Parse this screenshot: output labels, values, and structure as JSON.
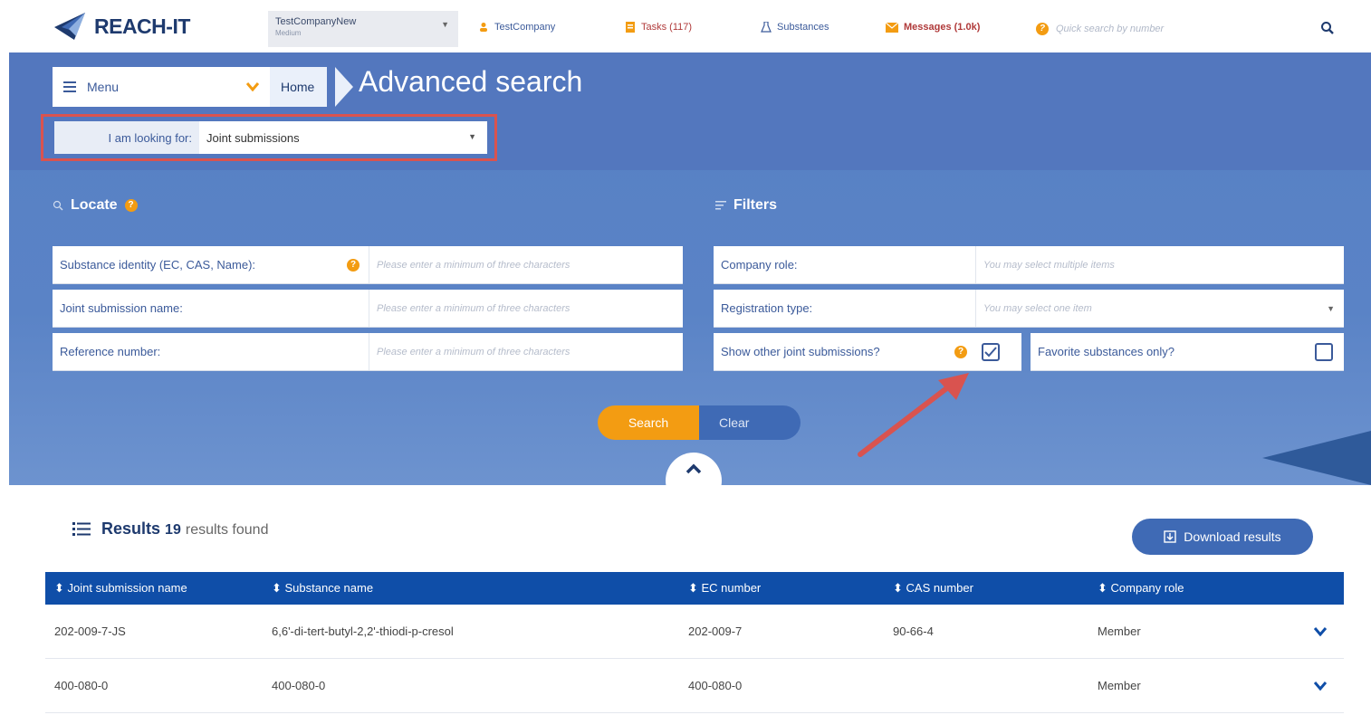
{
  "header": {
    "logo_text": "REACH-IT",
    "company": {
      "name": "TestCompanyNew",
      "size": "Medium"
    },
    "user": "TestCompany",
    "tasks": "Tasks (117)",
    "substances": "Substances",
    "messages": "Messages (1.0k)",
    "quick_search_placeholder": "Quick search by number"
  },
  "nav": {
    "menu_label": "Menu",
    "breadcrumb_home": "Home",
    "page_title": "Advanced search"
  },
  "looking_for": {
    "label": "I am looking for:",
    "value": "Joint submissions"
  },
  "locate": {
    "title": "Locate",
    "fields": [
      {
        "label": "Substance identity (EC, CAS, Name):",
        "placeholder": "Please enter a minimum of three characters"
      },
      {
        "label": "Joint submission name:",
        "placeholder": "Please enter a minimum of three characters"
      },
      {
        "label": "Reference number:",
        "placeholder": "Please enter a minimum of three characters"
      }
    ]
  },
  "filters": {
    "title": "Filters",
    "company_role": {
      "label": "Company role:",
      "placeholder": "You may select multiple items"
    },
    "registration_type": {
      "label": "Registration type:",
      "placeholder": "You may select one item"
    },
    "show_other": {
      "label": "Show other joint submissions?",
      "checked": true
    },
    "favorite_only": {
      "label": "Favorite substances only?",
      "checked": false
    }
  },
  "actions": {
    "search": "Search",
    "clear": "Clear"
  },
  "results": {
    "title": "Results",
    "count": "19",
    "suffix": "results found",
    "download": "Download results",
    "columns": [
      "Joint submission name",
      "Substance name",
      "EC number",
      "CAS number",
      "Company role"
    ],
    "rows": [
      [
        "202-009-7-JS",
        "6,6'-di-tert-butyl-2,2'-thiodi-p-cresol",
        "202-009-7",
        "90-66-4",
        "Member"
      ],
      [
        "400-080-0",
        "400-080-0",
        "400-080-0",
        "",
        "Member"
      ]
    ]
  },
  "colors": {
    "brand_blue": "#0f4ea8",
    "hero_blue": "#5780c4",
    "accent_orange": "#f39c12",
    "highlight_red": "#d9534f"
  }
}
